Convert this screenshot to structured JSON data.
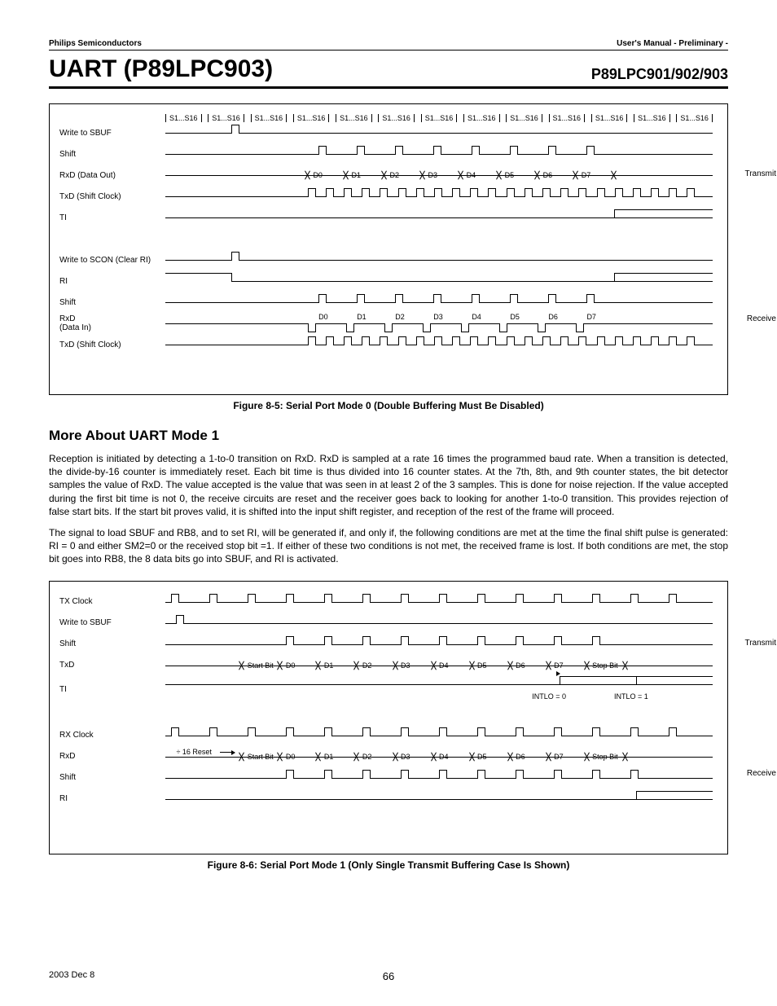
{
  "header": {
    "left": "Philips Semiconductors",
    "right": "User's Manual - Preliminary -"
  },
  "title": {
    "main": "UART (P89LPC903)",
    "right": "P89LPC901/902/903"
  },
  "chart_data": [
    {
      "type": "timing-diagram",
      "figure_id": "8-5",
      "title": "Serial Port Mode 0 (Double Buffering Must Be Disabled)",
      "tick_label": "S1...S16",
      "tick_count": 13,
      "groups": [
        {
          "name": "Transmit",
          "signals": [
            {
              "name": "Write to SBUF",
              "pulses_at": [
                0
              ]
            },
            {
              "name": "Shift",
              "pulses_at": [
                2,
                3,
                4,
                5,
                6,
                7,
                8,
                9
              ]
            },
            {
              "name": "RxD (Data Out)",
              "data_bits": [
                "D0",
                "D1",
                "D2",
                "D3",
                "D4",
                "D5",
                "D6",
                "D7"
              ],
              "start_tick": 2
            },
            {
              "name": "TxD (Shift Clock)",
              "clock_from_tick": 2,
              "clock_to_tick": 13
            },
            {
              "name": "TI",
              "step_high_at": 9
            }
          ]
        },
        {
          "name": "Receive",
          "signals": [
            {
              "name": "Write to SCON (Clear RI)",
              "pulses_at": [
                0
              ]
            },
            {
              "name": "RI",
              "step_high_at": 9,
              "initial_high_until": 0
            },
            {
              "name": "Shift",
              "pulses_at": [
                2,
                3,
                4,
                5,
                6,
                7,
                8,
                9
              ]
            },
            {
              "name": "RxD (Data In)",
              "data_bits": [
                "D0",
                "D1",
                "D2",
                "D3",
                "D4",
                "D5",
                "D6",
                "D7"
              ],
              "start_tick": 2,
              "notch_style": true
            },
            {
              "name": "TxD (Shift Clock)",
              "clock_from_tick": 2,
              "clock_to_tick": 13
            }
          ]
        }
      ]
    },
    {
      "type": "timing-diagram",
      "figure_id": "8-6",
      "title": "Serial Port Mode 1 (Only Single Transmit Buffering Case Is Shown)",
      "groups": [
        {
          "name": "Transmit",
          "signals": [
            {
              "name": "TX Clock",
              "pulses_at": [
                0,
                1,
                2,
                3,
                4,
                5,
                6,
                7,
                8,
                9,
                10,
                11,
                12,
                13
              ]
            },
            {
              "name": "Write to SBUF",
              "pulses_at": [
                0
              ]
            },
            {
              "name": "Shift",
              "pulses_at": [
                3,
                4,
                5,
                6,
                7,
                8,
                9,
                10,
                11
              ]
            },
            {
              "name": "TxD",
              "data_bits": [
                "Start Bit",
                "D0",
                "D1",
                "D2",
                "D3",
                "D4",
                "D5",
                "D6",
                "D7",
                "Stop Bit"
              ],
              "start_tick": 2
            },
            {
              "name": "TI",
              "step_high_at_options": {
                "INTLO=0": 10,
                "INTLO=1": 12
              }
            }
          ]
        },
        {
          "name": "Receive",
          "signals": [
            {
              "name": "RX Clock",
              "pulses_at": [
                0,
                1,
                2,
                3,
                4,
                5,
                6,
                7,
                8,
                9,
                10,
                11,
                12,
                13
              ]
            },
            {
              "name": "RxD",
              "prefix_label": "÷ 16 Reset",
              "data_bits": [
                "Start Bit",
                "D0",
                "D1",
                "D2",
                "D3",
                "D4",
                "D5",
                "D6",
                "D7",
                "Stop Bit"
              ],
              "start_tick": 2
            },
            {
              "name": "Shift",
              "pulses_at": [
                3,
                4,
                5,
                6,
                7,
                8,
                9,
                10,
                11,
                12
              ]
            },
            {
              "name": "RI",
              "step_high_at": 12
            }
          ]
        }
      ]
    }
  ],
  "fig1": {
    "caption": "Figure 8-5: Serial Port Mode 0 (Double Buffering Must Be Disabled)",
    "tick": "S1...S16",
    "labels": {
      "write_sbuf": "Write to SBUF",
      "shift": "Shift",
      "rxd_out": "RxD (Data Out)",
      "txd_clk": "TxD (Shift Clock)",
      "ti": "TI",
      "write_scon": "Write to SCON (Clear RI)",
      "ri": "RI",
      "rxd_in": "RxD",
      "rxd_in2": "(Data In)",
      "transmit": "Transmit",
      "receive": "Receive"
    },
    "bits": [
      "D0",
      "D1",
      "D2",
      "D3",
      "D4",
      "D5",
      "D6",
      "D7"
    ]
  },
  "section": {
    "h": "More About UART Mode 1"
  },
  "p1": "Reception is initiated by detecting a 1-to-0 transition on RxD. RxD is sampled at a rate 16 times the programmed baud rate. When a transition is detected, the divide-by-16 counter is immediately reset. Each bit time is thus divided into 16 counter states. At the 7th, 8th, and 9th counter states, the bit detector samples the value of RxD. The value accepted is the value that was seen in at least 2 of the 3 samples. This is done for noise rejection. If the value accepted during the first bit time is not 0, the receive circuits are reset and the receiver goes back to looking for another 1-to-0 transition. This provides rejection of false start bits. If the start bit proves valid, it is shifted into the input shift register, and reception of the rest of the frame will proceed.",
  "p2": "The signal to load SBUF and RB8, and to set RI, will be generated if, and only if, the following conditions are met at the time the final shift pulse is generated: RI = 0 and either SM2=0 or the received stop bit =1. If either of these two conditions is not met, the received frame is lost. If both conditions are met, the stop bit goes into RB8, the 8 data bits go into SBUF, and RI is activated.",
  "fig2": {
    "caption": "Figure 8-6: Serial Port Mode 1 (Only Single Transmit Buffering Case Is Shown)",
    "labels": {
      "txclk": "TX Clock",
      "write_sbuf": "Write to SBUF",
      "shift": "Shift",
      "txd": "TxD",
      "ti": "TI",
      "rxclk": "RX Clock",
      "rxd": "RxD",
      "ri": "RI",
      "start": "Start Bit",
      "stop": "Stop Bit",
      "div16": "÷ 16 Reset",
      "intlo0": "INTLO = 0",
      "intlo1": "INTLO = 1",
      "transmit": "Transmit",
      "receive": "Receive"
    },
    "bits": [
      "D0",
      "D1",
      "D2",
      "D3",
      "D4",
      "D5",
      "D6",
      "D7"
    ]
  },
  "footer": {
    "date": "2003 Dec 8",
    "page": "66"
  }
}
